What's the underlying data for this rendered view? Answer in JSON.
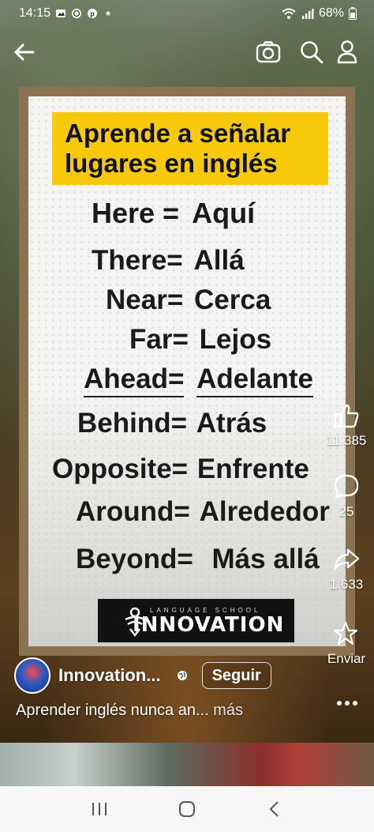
{
  "status_bar": {
    "time": "14:15",
    "battery": "68%"
  },
  "poster": {
    "headline_line1": "Aprende a señalar",
    "headline_line2": "lugares en inglés",
    "vocab": [
      {
        "en": "Here =",
        "es": "Aquí"
      },
      {
        "en": "There=",
        "es": "Allá"
      },
      {
        "en": "Near=",
        "es": "Cerca"
      },
      {
        "en": "Far=",
        "es": "Lejos"
      },
      {
        "en": "Ahead=",
        "es": "Adelante"
      },
      {
        "en": "Behind=",
        "es": "Atrás"
      },
      {
        "en": "Opposite=",
        "es": "Enfrente"
      },
      {
        "en": "Around=",
        "es": "Alrededor"
      },
      {
        "en": "Beyond=",
        "es": "Más allá"
      }
    ],
    "logo_tagline": "LANGUAGE SCHOOL",
    "logo_word": "INNOVATION"
  },
  "actions": {
    "likes": "11.385",
    "comments": "25",
    "shares": "1.633",
    "send_label": "Enviar"
  },
  "author": {
    "name": "Innovation...",
    "follow_label": "Seguir"
  },
  "caption": {
    "text": "Aprender inglés nunca an...",
    "more": "más"
  },
  "icons": {
    "back": "arrow-left-icon",
    "camera": "camera-icon",
    "search": "search-icon",
    "profile": "person-icon",
    "like": "thumbs-up-icon",
    "comment": "comment-icon",
    "share": "share-arrow-icon",
    "send": "send-icon",
    "more": "more-dots-icon"
  }
}
